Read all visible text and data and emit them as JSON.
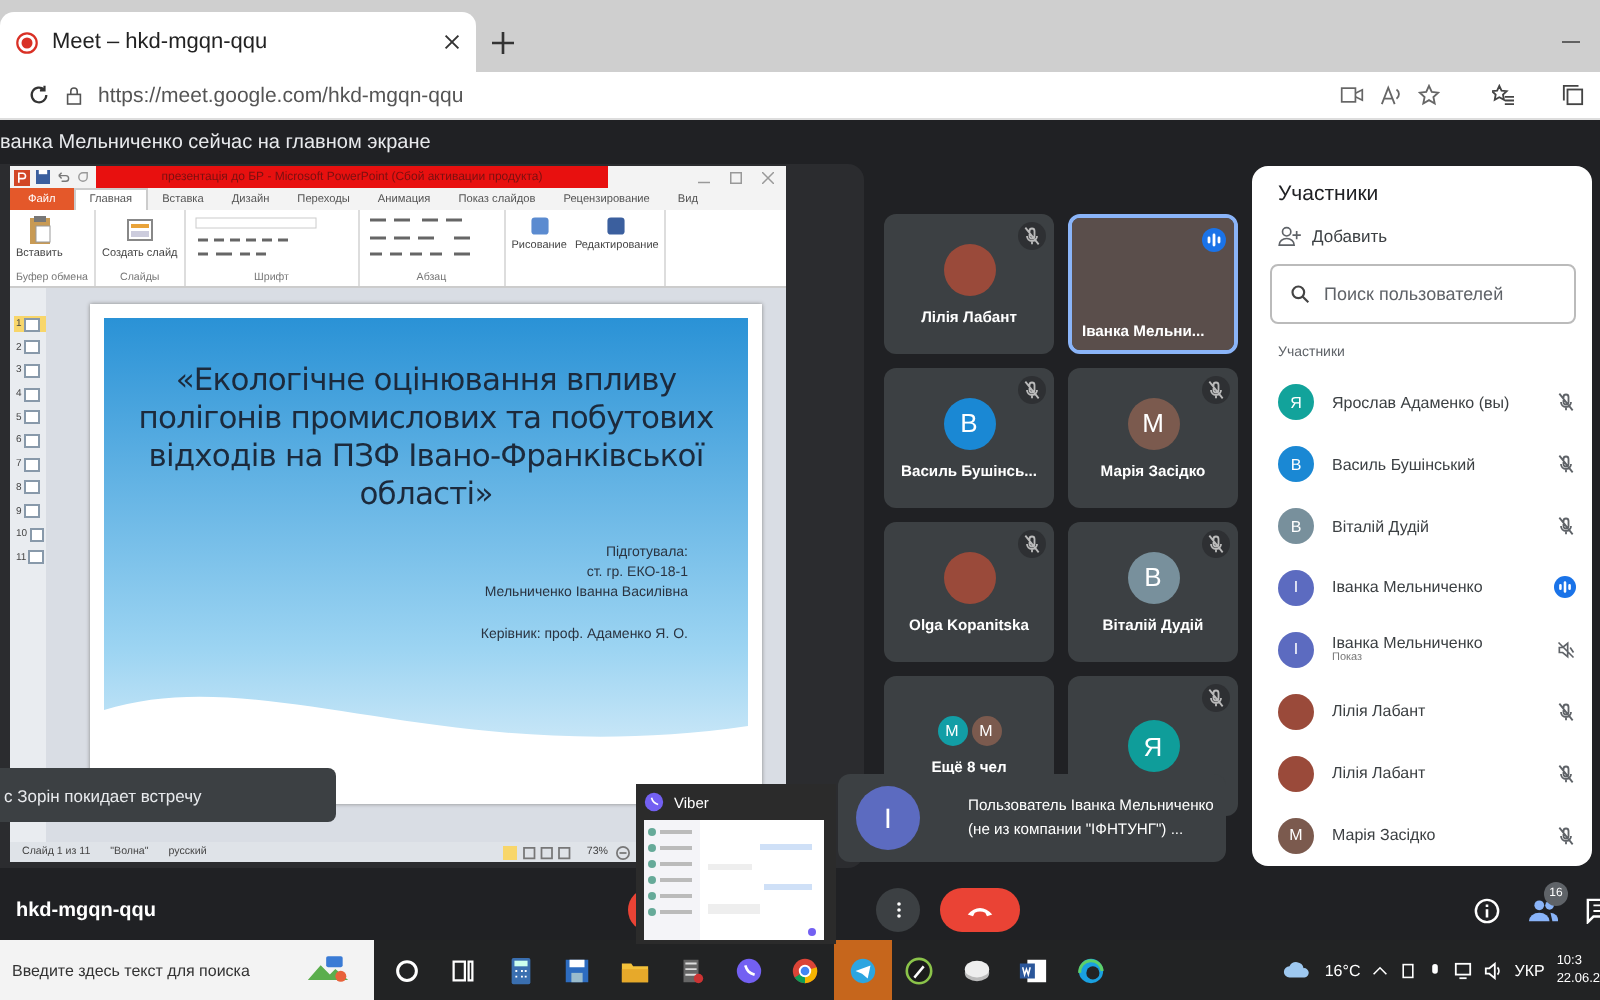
{
  "browser": {
    "tab_title": "Meet – hkd-mgqn-qqu",
    "url": "https://meet.google.com/hkd-mgqn-qqu"
  },
  "meet": {
    "banner": "ванка Мельниченко сейчас на главном экране",
    "presentation": {
      "title_bar": "презентація до БР  -  Microsoft PowerPoint (Сбой активации продукта)",
      "ribbon_tabs": [
        {
          "label": "Файл",
          "kind": "file",
          "selected": false
        },
        {
          "label": "Главная",
          "kind": "tab",
          "selected": true
        },
        {
          "label": "Вставка",
          "kind": "tab",
          "selected": false
        },
        {
          "label": "Дизайн",
          "kind": "tab",
          "selected": false
        },
        {
          "label": "Переходы",
          "kind": "tab",
          "selected": false
        },
        {
          "label": "Анимация",
          "kind": "tab",
          "selected": false
        },
        {
          "label": "Показ слайдов",
          "kind": "tab",
          "selected": false
        },
        {
          "label": "Рецензирование",
          "kind": "tab",
          "selected": false
        },
        {
          "label": "Вид",
          "kind": "tab",
          "selected": false
        }
      ],
      "ribbon_groups": [
        {
          "label": "Буфер обмена",
          "kind": "clipboard",
          "buttons": [
            "Вставить"
          ]
        },
        {
          "label": "Слайды",
          "kind": "slides",
          "buttons": [
            "Создать слайд"
          ]
        },
        {
          "label": "Шрифт",
          "kind": "font"
        },
        {
          "label": "Абзац",
          "kind": "paragraph"
        },
        {
          "kind": "tools",
          "buttons": [
            "Рисование",
            "Редактирование"
          ]
        }
      ],
      "thumbnails": [
        {
          "number": "1",
          "selected": true
        },
        {
          "number": "2",
          "selected": false
        },
        {
          "number": "3",
          "selected": false
        },
        {
          "number": "4",
          "selected": false
        },
        {
          "number": "5",
          "selected": false
        },
        {
          "number": "6",
          "selected": false
        },
        {
          "number": "7",
          "selected": false
        },
        {
          "number": "8",
          "selected": false
        },
        {
          "number": "9",
          "selected": false
        },
        {
          "number": "10",
          "selected": false
        },
        {
          "number": "11",
          "selected": false
        }
      ],
      "slide": {
        "title": "«Екологічне оцінювання впливу полігонів промислових та побутових відходів на ПЗФ Івано-Франківської області»",
        "lines": [
          "Підготувала:",
          "ст. гр. ЕКО-18-1",
          "Мельниченко  Іванна  Василівна"
        ],
        "supervisor": "Керівник: проф. Адаменко Я. О."
      },
      "status": [
        "Слайд 1 из 11",
        "\"Волна\"",
        "русский"
      ],
      "zoom": "73%"
    },
    "tiles": [
      {
        "kind": "photo",
        "name": "Лілія Лабант",
        "muted": true,
        "speaking": false
      },
      {
        "kind": "video",
        "name": "Іванка Мельни...",
        "muted": false,
        "speaking": true
      },
      {
        "kind": "initial",
        "initial": "В",
        "color": "#1a88d4",
        "name": "Василь Бушінсь...",
        "muted": true,
        "speaking": false
      },
      {
        "kind": "initial",
        "initial": "М",
        "color": "#7b5a4e",
        "name": "Марія Засідко",
        "muted": true,
        "speaking": false
      },
      {
        "kind": "photo",
        "name": "Olga Kopanitska",
        "muted": true,
        "speaking": false
      },
      {
        "kind": "initial",
        "initial": "В",
        "color": "#78909c",
        "name": "Віталій Дудій",
        "muted": true,
        "speaking": false
      },
      {
        "kind": "more",
        "name": "Ещё 8 чел",
        "avatars": [
          {
            "initial": "M",
            "color": "#129ea6"
          },
          {
            "initial": "M",
            "color": "#7b5a4e"
          }
        ],
        "muted": false,
        "speaking": false
      },
      {
        "kind": "initial",
        "initial": "Я",
        "color": "#0f9d9a",
        "muted": true,
        "speaking": false
      }
    ],
    "panel": {
      "title": "Участники",
      "add": "Добавить",
      "search_placeholder": "Поиск пользователей",
      "section": "Участники",
      "people": [
        {
          "kind": "initial",
          "initial": "Я",
          "color": "#12a39b",
          "name": "Ярослав Адаменко (вы)",
          "muted": true
        },
        {
          "kind": "initial",
          "initial": "В",
          "color": "#1a88d4",
          "name": "Василь Бушінський",
          "muted": true
        },
        {
          "kind": "initial",
          "initial": "В",
          "color": "#78909c",
          "name": "Віталій Дудій",
          "muted": true
        },
        {
          "kind": "initial",
          "initial": "I",
          "color": "#5c6bc0",
          "name": "Іванка Мельниченко",
          "speaking": true
        },
        {
          "kind": "initial",
          "initial": "I",
          "color": "#5c6bc0",
          "name": "Іванка Мельниченко",
          "subtitle": "Показ",
          "sound_muted": true
        },
        {
          "kind": "photo",
          "name": "Лілія Лабант",
          "muted": true
        },
        {
          "kind": "photo",
          "name": "Лілія Лабант",
          "muted": true
        },
        {
          "kind": "initial",
          "initial": "М",
          "color": "#7b5a4e",
          "name": "Марія Засідко",
          "muted": true
        }
      ]
    },
    "toast": "с Зорін покидает встречу",
    "notification": {
      "initial": "I",
      "text": "Пользователь Іванка Мельниченко (не из компании \"ІФНТУНГ\") ..."
    },
    "viber_preview": {
      "title": "Viber"
    },
    "meeting_code": "hkd-mgqn-qqu",
    "people_count": "16"
  },
  "taskbar": {
    "search_placeholder": "Введите здесь текст для поиска",
    "apps": [
      {
        "kind": "cortana",
        "selected": false
      },
      {
        "kind": "taskview",
        "selected": false
      },
      {
        "kind": "calculator",
        "selected": false
      },
      {
        "kind": "save",
        "selected": false
      },
      {
        "kind": "folder",
        "selected": false
      },
      {
        "kind": "tool",
        "selected": false
      },
      {
        "kind": "viber",
        "selected": false
      },
      {
        "kind": "chrome",
        "selected": false
      },
      {
        "kind": "telegram",
        "selected": true
      },
      {
        "kind": "pen",
        "selected": false
      },
      {
        "kind": "disk",
        "selected": false
      },
      {
        "kind": "word",
        "selected": false
      },
      {
        "kind": "edge",
        "selected": false
      }
    ],
    "temperature": "16°C",
    "language": "УКР",
    "time": "10:3",
    "date": "22.06.2"
  }
}
